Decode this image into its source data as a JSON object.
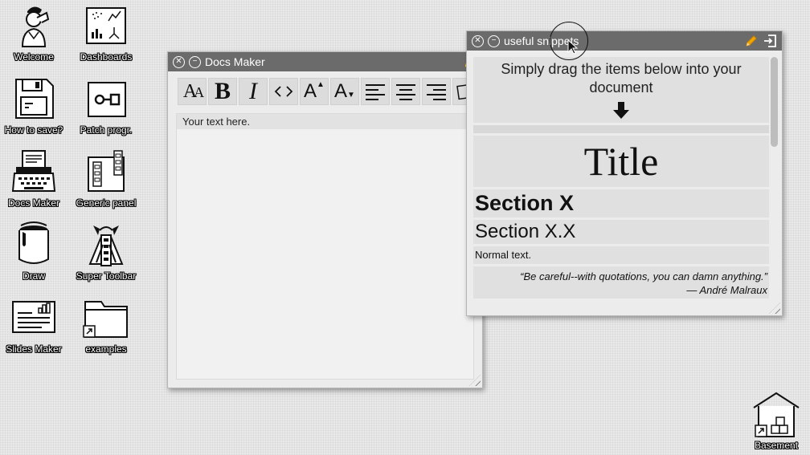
{
  "desktop": {
    "icons": [
      {
        "label": "Welcome",
        "icon": "person-icon"
      },
      {
        "label": "Dashboards",
        "icon": "dashboard-icon"
      },
      {
        "label": "How to save?",
        "icon": "floppy-disk-icon"
      },
      {
        "label": "Patch progr.",
        "icon": "patch-icon"
      },
      {
        "label": "Docs Maker",
        "icon": "typewriter-icon"
      },
      {
        "label": "Generic panel",
        "icon": "panel-icon"
      },
      {
        "label": "Draw",
        "icon": "paint-bucket-icon"
      },
      {
        "label": "Super Toolbar",
        "icon": "toolbar-icon"
      },
      {
        "label": "Slides Maker",
        "icon": "slides-icon"
      },
      {
        "label": "examples",
        "icon": "folder-icon"
      }
    ],
    "basement": {
      "label": "Basement",
      "icon": "warehouse-icon"
    }
  },
  "docs_window": {
    "title": "Docs Maker",
    "tools": [
      "font-icon",
      "bold-icon",
      "italic-icon",
      "code-icon",
      "font-size-up-icon",
      "font-size-down-icon",
      "align-left-icon",
      "align-center-icon",
      "align-right-icon",
      "image-icon"
    ],
    "body_text": "Your text here."
  },
  "snippets_window": {
    "title": "useful snippets",
    "instruction": "Simply drag the items below into your document",
    "title_sample": "Title",
    "section": "Section X",
    "subsection": "Section X.X",
    "normal": "Normal text.",
    "quote": "“Be careful--with quotations, you can damn anything.”",
    "quote_author": "— André Malraux"
  }
}
